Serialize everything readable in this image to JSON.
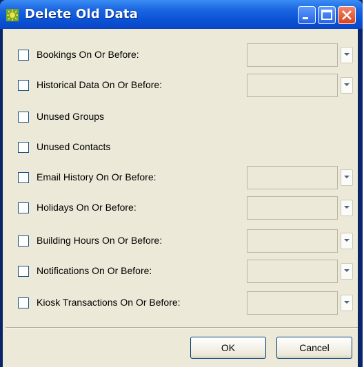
{
  "window": {
    "title": "Delete Old Data"
  },
  "options": [
    {
      "label": "Bookings On Or Before:",
      "has_date": true,
      "checked": false,
      "date_value": ""
    },
    {
      "label": "Historical Data On Or Before:",
      "has_date": true,
      "checked": false,
      "date_value": ""
    },
    {
      "label": "Unused Groups",
      "has_date": false,
      "checked": false
    },
    {
      "label": "Unused Contacts",
      "has_date": false,
      "checked": false
    },
    {
      "label": "Email History On Or Before:",
      "has_date": true,
      "checked": false,
      "date_value": ""
    },
    {
      "label": "Holidays On Or Before:",
      "has_date": true,
      "checked": false,
      "date_value": ""
    },
    {
      "label": "Building Hours On Or Before:",
      "has_date": true,
      "checked": false,
      "date_value": ""
    },
    {
      "label": "Notifications On Or Before:",
      "has_date": true,
      "checked": false,
      "date_value": ""
    },
    {
      "label": "Kiosk Transactions On Or Before:",
      "has_date": true,
      "checked": false,
      "date_value": ""
    }
  ],
  "buttons": {
    "ok": "OK",
    "cancel": "Cancel"
  },
  "icons": {
    "app": "sunburst-icon",
    "minimize": "minimize-icon",
    "maximize": "maximize-icon",
    "close": "close-icon",
    "dropdown": "chevron-down-icon"
  },
  "colors": {
    "titlebar": "#0a52d6",
    "dialog_bg": "#ece9d8",
    "close_button": "#d9431e",
    "checkbox_border": "#1c5180"
  }
}
